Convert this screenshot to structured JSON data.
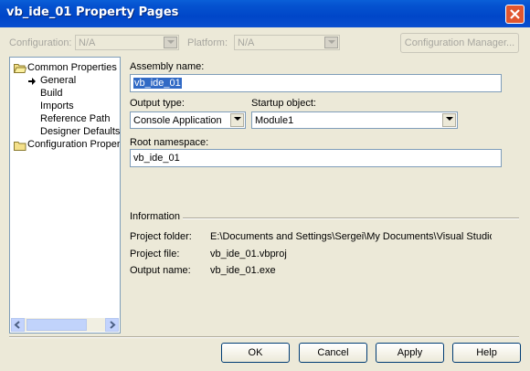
{
  "window": {
    "title": "vb_ide_01 Property Pages"
  },
  "config": {
    "configuration_label": "Configuration:",
    "configuration_value": "N/A",
    "platform_label": "Platform:",
    "platform_value": "N/A",
    "config_manager_label": "Configuration Manager..."
  },
  "tree": {
    "root_label": "Common Properties",
    "items": [
      "General",
      "Build",
      "Imports",
      "Reference Path",
      "Designer Defaults"
    ],
    "second_root_label": "Configuration Properties"
  },
  "form": {
    "assembly_name_label": "Assembly name:",
    "assembly_name_value": "vb_ide_01",
    "output_type_label": "Output type:",
    "output_type_value": "Console Application",
    "startup_object_label": "Startup object:",
    "startup_object_value": "Module1",
    "root_namespace_label": "Root namespace:",
    "root_namespace_value": "vb_ide_01"
  },
  "info": {
    "heading": "Information",
    "project_folder_label": "Project folder:",
    "project_folder_value": "E:\\Documents and Settings\\Sergei\\My Documents\\Visual Studio Proje",
    "project_file_label": "Project file:",
    "project_file_value": "vb_ide_01.vbproj",
    "output_name_label": "Output name:",
    "output_name_value": "vb_ide_01.exe"
  },
  "buttons": {
    "ok": "OK",
    "cancel": "Cancel",
    "apply": "Apply",
    "help": "Help"
  },
  "colors": {
    "title_bar": "#0046c8",
    "dialog_bg": "#ece9d8",
    "selection": "#316ac5",
    "close_button": "#e0562f"
  }
}
